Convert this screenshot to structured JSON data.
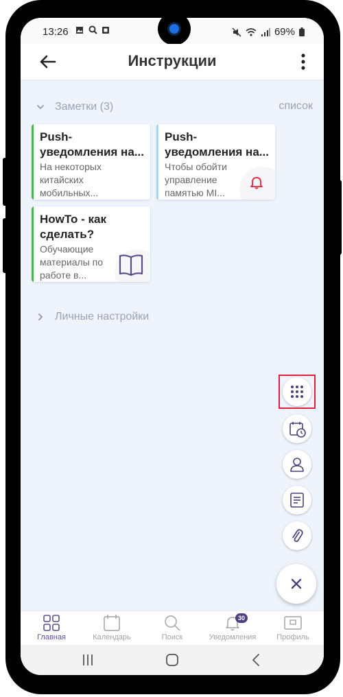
{
  "status_bar": {
    "time": "13:26",
    "left_icons": [
      "image-icon",
      "search-icon",
      "screenshot-icon"
    ],
    "right_icons": [
      "mute-icon",
      "wifi-icon",
      "signal-icon"
    ],
    "battery": "69%"
  },
  "app_bar": {
    "title": "Инструкции",
    "back_icon": "arrow-left-icon",
    "menu_icon": "more-vert-icon"
  },
  "notes_section": {
    "label": "Заметки (3)",
    "view_mode": "список",
    "cards": [
      {
        "title": "Push-уведомления на...",
        "text": "На некоторых китайских мобильных...",
        "accent": "#4caf50",
        "icon": null
      },
      {
        "title": "Push-уведомления на...",
        "text": "Чтобы обойти управление памятью MI...",
        "accent": "#a9d7ea",
        "icon": "bell-icon"
      },
      {
        "title": "HowTo - как сделать?",
        "text": "Обучающие материалы по работе в...",
        "accent": "#4caf50",
        "icon": "book-icon"
      }
    ]
  },
  "settings_section": {
    "label": "Личные настройки"
  },
  "fab_menu": {
    "items": [
      "apps-grid-icon",
      "calendar-clock-icon",
      "person-icon",
      "note-icon",
      "paperclip-icon"
    ],
    "close_icon": "close-icon",
    "accent": "#4c3f7c"
  },
  "bottom_nav": {
    "items": [
      {
        "label": "Главная",
        "icon": "home-grid-icon",
        "active": true
      },
      {
        "label": "Календарь",
        "icon": "calendar-icon",
        "active": false
      },
      {
        "label": "Поиск",
        "icon": "search-icon",
        "active": false
      },
      {
        "label": "Уведомления",
        "icon": "bell-icon",
        "active": false,
        "badge": "30"
      },
      {
        "label": "Профиль",
        "icon": "profile-card-icon",
        "active": false
      }
    ]
  },
  "system_nav": [
    "recents-icon",
    "home-icon",
    "back-icon"
  ],
  "colors": {
    "highlight": "#e0203a",
    "card_icon": "#5b4b86",
    "bell": "#e0203a"
  }
}
